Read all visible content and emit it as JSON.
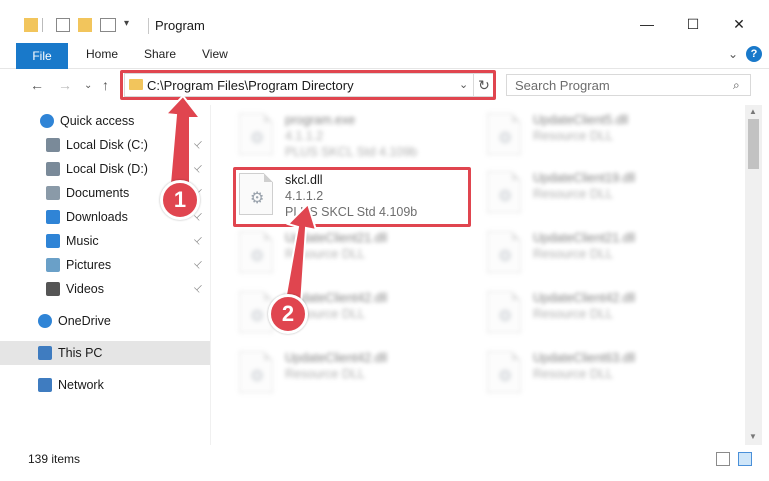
{
  "window": {
    "title": "Program",
    "controls": {
      "minimize": "—",
      "maximize": "☐",
      "close": "✕"
    }
  },
  "ribbon": {
    "file": "File",
    "tabs": [
      "Home",
      "Share",
      "View"
    ],
    "collapse_glyph": "⌄",
    "help_glyph": "?"
  },
  "nav": {
    "back": "←",
    "forward": "→",
    "recent": "⌄",
    "up": "↑",
    "address": "C:\\Program Files\\Program Directory",
    "address_dd": "⌄",
    "refresh": "↻",
    "search_placeholder": "Search Program",
    "search_icon_glyph": "⌕"
  },
  "sidebar": {
    "items": [
      {
        "label": "Quick access",
        "icon": "star-icon",
        "pinned": false
      },
      {
        "label": "Local Disk (C:)",
        "icon": "drive-icon",
        "pinned": true
      },
      {
        "label": "Local Disk (D:)",
        "icon": "drive-icon",
        "pinned": true
      },
      {
        "label": "Documents",
        "icon": "documents-icon",
        "pinned": true
      },
      {
        "label": "Downloads",
        "icon": "download-icon",
        "pinned": true
      },
      {
        "label": "Music",
        "icon": "music-icon",
        "pinned": true
      },
      {
        "label": "Pictures",
        "icon": "pictures-icon",
        "pinned": true
      },
      {
        "label": "Videos",
        "icon": "videos-icon",
        "pinned": true
      },
      {
        "label": "OneDrive",
        "icon": "cloud-icon",
        "pinned": false
      },
      {
        "label": "This PC",
        "icon": "computer-icon",
        "pinned": false,
        "selected": true
      },
      {
        "label": "Network",
        "icon": "network-icon",
        "pinned": false
      }
    ],
    "pin_glyph": "📌"
  },
  "files": [
    {
      "name": "program.exe",
      "line1": "4.1.1.2",
      "line2": "PLUS SKCL Std 4.109b",
      "blurred": true,
      "icon": "exe-icon"
    },
    {
      "name": "UpdateClient5.dll",
      "line1": "Resource DLL",
      "line2": "",
      "blurred": true,
      "icon": "dll-icon"
    },
    {
      "name": "skcl.dll",
      "line1": "4.1.1.2",
      "line2": "PLUS SKCL Std 4.109b",
      "blurred": false,
      "icon": "dll-icon"
    },
    {
      "name": "UpdateClient19.dll",
      "line1": "Resource DLL",
      "line2": "",
      "blurred": true,
      "icon": "dll-icon"
    },
    {
      "name": "UpdateClient21.dll",
      "line1": "Resource DLL",
      "line2": "",
      "blurred": true,
      "icon": "dll-icon"
    },
    {
      "name": "UpdateClient21.dll",
      "line1": "Resource DLL",
      "line2": "",
      "blurred": true,
      "icon": "dll-icon"
    },
    {
      "name": "UpdateClient42.dll",
      "line1": "Resource DLL",
      "line2": "",
      "blurred": true,
      "icon": "dll-icon"
    },
    {
      "name": "UpdateClient42.dll",
      "line1": "Resource DLL",
      "line2": "",
      "blurred": true,
      "icon": "dll-icon"
    },
    {
      "name": "UpdateClient42.dll",
      "line1": "Resource DLL",
      "line2": "",
      "blurred": true,
      "icon": "dll-icon"
    },
    {
      "name": "UpdateClient63.dll",
      "line1": "Resource DLL",
      "line2": "",
      "blurred": true,
      "icon": "dll-icon"
    }
  ],
  "status": {
    "count": "139 items"
  },
  "annotations": {
    "step1": "1",
    "step2": "2",
    "color": "#e0454f"
  }
}
